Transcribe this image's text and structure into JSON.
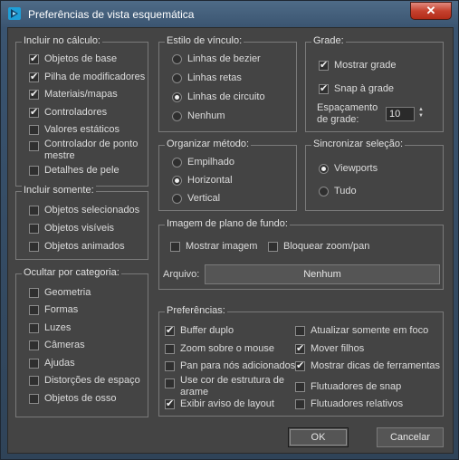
{
  "window": {
    "title": "Preferências de vista esquemática",
    "close_label": "✕"
  },
  "include_calc": {
    "title": "Incluir no cálculo:",
    "items": [
      {
        "label": "Objetos de base",
        "checked": true
      },
      {
        "label": "Pilha de modificadores",
        "checked": true
      },
      {
        "label": "Materiais/mapas",
        "checked": true
      },
      {
        "label": "Controladores",
        "checked": true
      },
      {
        "label": "Valores estáticos",
        "checked": false
      },
      {
        "label": "Controlador de ponto mestre",
        "checked": false
      },
      {
        "label": "Detalhes de pele",
        "checked": false
      }
    ]
  },
  "include_only": {
    "title": "Incluir somente:",
    "items": [
      {
        "label": "Objetos selecionados",
        "checked": false
      },
      {
        "label": "Objetos visíveis",
        "checked": false
      },
      {
        "label": "Objetos animados",
        "checked": false
      }
    ]
  },
  "hide_category": {
    "title": "Ocultar por categoria:",
    "items": [
      {
        "label": "Geometria",
        "checked": false
      },
      {
        "label": "Formas",
        "checked": false
      },
      {
        "label": "Luzes",
        "checked": false
      },
      {
        "label": "Câmeras",
        "checked": false
      },
      {
        "label": "Ajudas",
        "checked": false
      },
      {
        "label": "Distorções de espaço",
        "checked": false
      },
      {
        "label": "Objetos de osso",
        "checked": false
      }
    ]
  },
  "link_style": {
    "title": "Estilo de vínculo:",
    "items": [
      {
        "label": "Linhas de bezier",
        "checked": false
      },
      {
        "label": "Linhas retas",
        "checked": false
      },
      {
        "label": "Linhas de circuito",
        "checked": true
      },
      {
        "label": "Nenhum",
        "checked": false
      }
    ]
  },
  "grid": {
    "title": "Grade:",
    "show_grid": {
      "label": "Mostrar grade",
      "checked": true
    },
    "snap_grid": {
      "label": "Snap à grade",
      "checked": true
    },
    "spacing_label": "Espaçamento de grade:",
    "spacing_value": "10"
  },
  "arrange": {
    "title": "Organizar método:",
    "items": [
      {
        "label": "Empilhado",
        "checked": false
      },
      {
        "label": "Horizontal",
        "checked": true
      },
      {
        "label": "Vertical",
        "checked": false
      }
    ]
  },
  "sync": {
    "title": "Sincronizar seleção:",
    "items": [
      {
        "label": "Viewports",
        "checked": true
      },
      {
        "label": "Tudo",
        "checked": false
      }
    ]
  },
  "background": {
    "title": "Imagem de plano de fundo:",
    "show_image": {
      "label": "Mostrar imagem",
      "checked": false
    },
    "lock_zoom": {
      "label": "Bloquear zoom/pan",
      "checked": false
    },
    "file_label": "Arquivo:",
    "file_button": "Nenhum"
  },
  "preferences": {
    "title": "Preferências:",
    "left": [
      {
        "label": "Buffer duplo",
        "checked": true
      },
      {
        "label": "Zoom sobre o mouse",
        "checked": false
      },
      {
        "label": "Pan para nós adicionados",
        "checked": false
      },
      {
        "label": "Use cor de estrutura de arame",
        "checked": false
      },
      {
        "label": "Exibir aviso de layout",
        "checked": true
      }
    ],
    "right": [
      {
        "label": "Atualizar somente em foco",
        "checked": false
      },
      {
        "label": "Mover filhos",
        "checked": true
      },
      {
        "label": "Mostrar dicas de ferramentas",
        "checked": true
      },
      {
        "label": "Flutuadores de snap",
        "checked": false
      },
      {
        "label": "Flutuadores relativos",
        "checked": false
      }
    ]
  },
  "buttons": {
    "ok": "OK",
    "cancel": "Cancelar"
  }
}
